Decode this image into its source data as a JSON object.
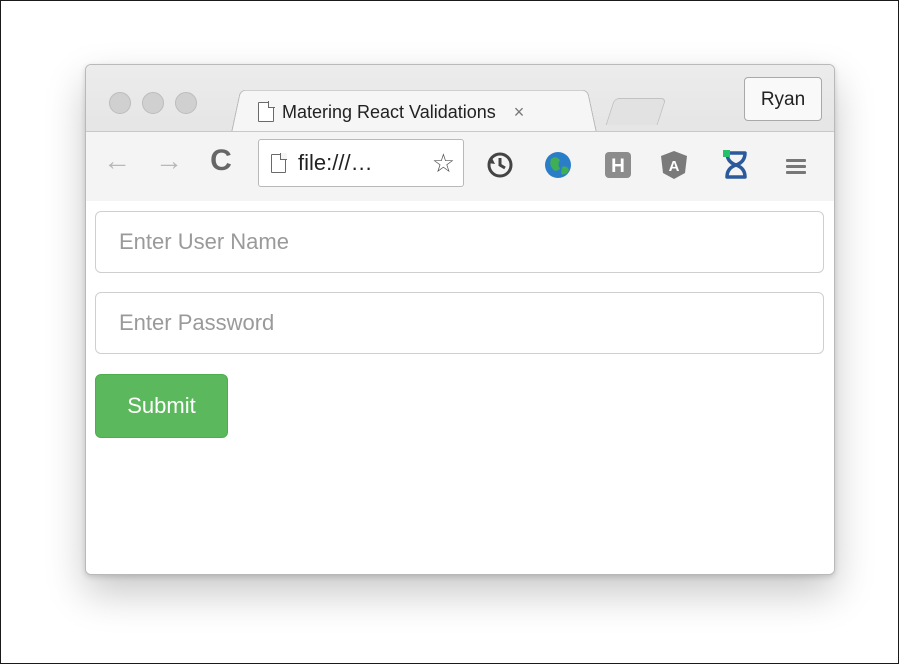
{
  "tab": {
    "title": "Matering React Validations",
    "close_glyph": "×",
    "icon": "page-icon"
  },
  "profile": {
    "name": "Ryan"
  },
  "toolbar": {
    "back_glyph": "←",
    "forward_glyph": "→",
    "reload_glyph": "C",
    "address": "file:///…",
    "bookmark_glyph": "☆",
    "extensions": [
      "sync-extension-icon",
      "globe-extension-icon",
      "h-extension-icon",
      "angular-extension-icon",
      "hourglass-extension-icon"
    ],
    "h_label": "H",
    "angular_label": "A"
  },
  "form": {
    "username_placeholder": "Enter User Name",
    "password_placeholder": "Enter Password",
    "submit_label": "Submit"
  },
  "colors": {
    "submit_bg": "#5cb85c",
    "globe_blue": "#2a7ec8",
    "globe_green": "#3fae55",
    "hourglass_blue": "#2a5a9c",
    "hourglass_green": "#25c06b"
  }
}
